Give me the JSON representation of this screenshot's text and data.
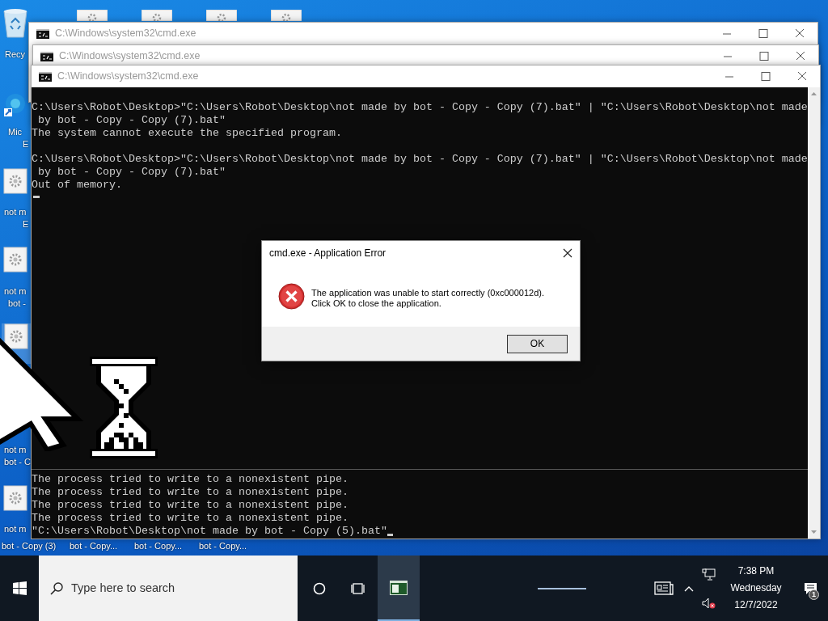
{
  "desktop_icons": [
    {
      "kind": "recycle",
      "labels": [
        "Recy"
      ]
    },
    {
      "kind": "edge",
      "labels": [
        "Mic",
        "E"
      ]
    },
    {
      "kind": "file",
      "labels": [
        "not m",
        "E"
      ]
    },
    {
      "kind": "file",
      "labels": [
        "not m",
        "bot -"
      ]
    },
    {
      "kind": "file",
      "selected": true,
      "labels": [
        "not m",
        "bot - C"
      ]
    },
    {
      "kind": "file",
      "labels": [
        "not m",
        "bot - Copy (3)"
      ]
    },
    {
      "kind": "file",
      "labels": [
        "bot - Copy..."
      ]
    },
    {
      "kind": "file",
      "labels": [
        "bot - Copy..."
      ]
    },
    {
      "kind": "file",
      "labels": [
        "bot - Copy..."
      ]
    }
  ],
  "windows": [
    {
      "title": "C:\\Windows\\system32\\cmd.exe"
    },
    {
      "title": "C:\\Windows\\system32\\cmd.exe"
    },
    {
      "title": "C:\\Windows\\system32\\cmd.exe"
    }
  ],
  "console": {
    "blocks": [
      [
        "C:\\Users\\Robot\\Desktop>\"C:\\Users\\Robot\\Desktop\\not made by bot - Copy - Copy (7).bat\" | \"C:\\Users\\Robot\\Desktop\\not made",
        " by bot - Copy - Copy (7).bat\"",
        "The system cannot execute the specified program."
      ],
      [
        "C:\\Users\\Robot\\Desktop>\"C:\\Users\\Robot\\Desktop\\not made by bot - Copy - Copy (7).bat\" | \"C:\\Users\\Robot\\Desktop\\not made",
        " by bot - Copy - Copy (7).bat\"",
        "Out of memory."
      ]
    ],
    "bottom_lines": [
      "The process tried to write to a nonexistent pipe.",
      "The process tried to write to a nonexistent pipe.",
      "The process tried to write to a nonexistent pipe.",
      "The process tried to write to a nonexistent pipe.",
      "\"C:\\Users\\Robot\\Desktop\\not made by bot - Copy (5).bat\""
    ]
  },
  "dialog": {
    "title": "cmd.exe - Application Error",
    "message": [
      "The application was unable to start correctly (0xc000012d).",
      "Click OK to close the application."
    ],
    "button": "OK"
  },
  "taskbar": {
    "search_placeholder": "Type here to search",
    "apps": [
      {
        "kind": "cmd",
        "active": true
      }
    ],
    "time": "7:38 PM",
    "day": "Wednesday",
    "date": "12/7/2022",
    "notification_count": "1"
  }
}
